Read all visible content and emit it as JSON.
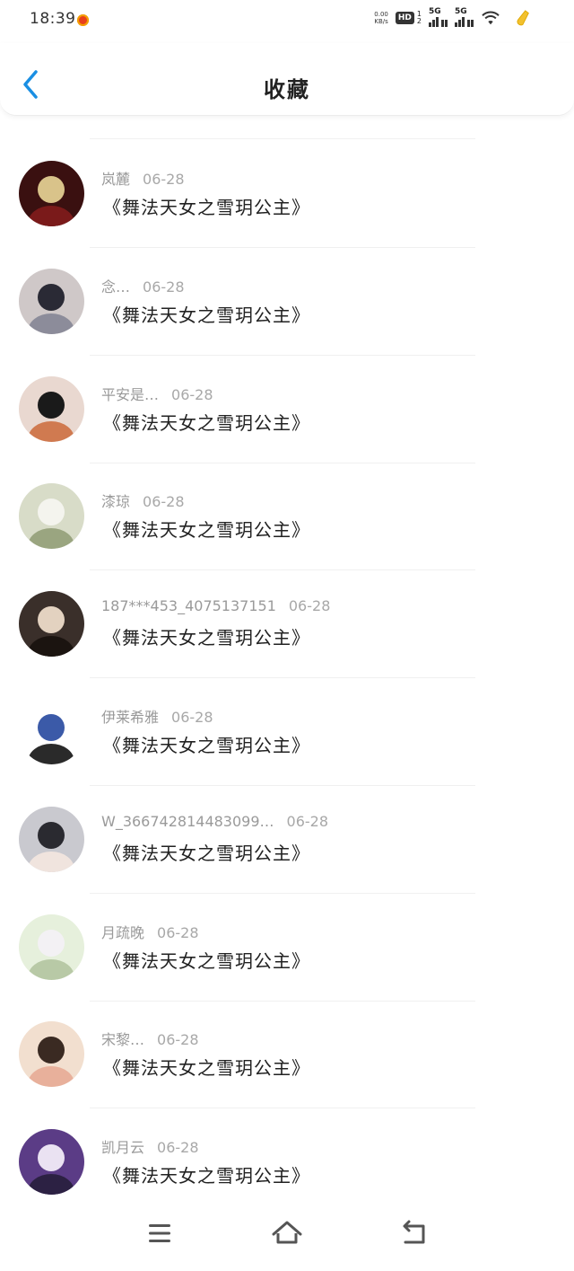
{
  "status_bar": {
    "time": "18:39",
    "net_speed_value": "0.00",
    "net_speed_unit": "KB/s",
    "hd_label": "HD",
    "sim_sub": "1\n2",
    "sim1_label": "5G",
    "sim2_label": "5G",
    "icons": [
      "notification-icon",
      "hd-icon",
      "signal-icon",
      "wifi-icon",
      "battery-icon"
    ]
  },
  "header": {
    "title": "收藏",
    "back_icon": "chevron-left-icon",
    "accent_color": "#1a8fe3"
  },
  "favorites": [
    {
      "user": "岚麓",
      "date": "06-28",
      "title": "《舞法天女之雪玥公主》"
    },
    {
      "user": "念…",
      "date": "06-28",
      "title": "《舞法天女之雪玥公主》"
    },
    {
      "user": "平安是…",
      "date": "06-28",
      "title": "《舞法天女之雪玥公主》"
    },
    {
      "user": "漆琼",
      "date": "06-28",
      "title": "《舞法天女之雪玥公主》"
    },
    {
      "user": "187***453_4075137151",
      "date": "06-28",
      "title": "《舞法天女之雪玥公主》"
    },
    {
      "user": "伊莱希雅",
      "date": "06-28",
      "title": "《舞法天女之雪玥公主》"
    },
    {
      "user": "W_3667428144830​99…",
      "date": "06-28",
      "title": "《舞法天女之雪玥公主》"
    },
    {
      "user": "月疏晚",
      "date": "06-28",
      "title": "《舞法天女之雪玥公主》"
    },
    {
      "user": "宋黎…",
      "date": "06-28",
      "title": "《舞法天女之雪玥公主》"
    },
    {
      "user": "凯月云",
      "date": "06-28",
      "title": "《舞法天女之雪玥公主》"
    }
  ],
  "nav_bar": {
    "icons": [
      "menu-icon",
      "home-icon",
      "back-icon"
    ]
  }
}
